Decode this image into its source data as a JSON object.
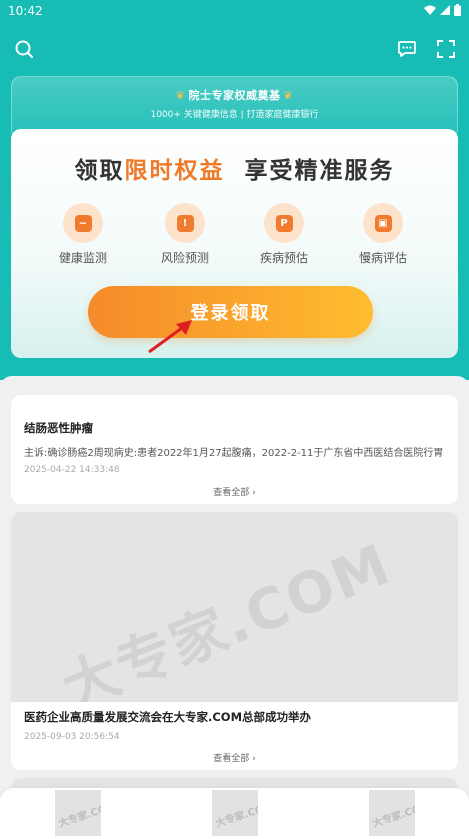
{
  "status_bar": {
    "time": "10:42"
  },
  "banner": {
    "line1": "院士专家权威奠基",
    "line2": "1000+ 关键健康信息 | 打造家庭健康银行"
  },
  "promo": {
    "headline_a": "领取",
    "headline_highlight": "限时权益",
    "headline_b": "享受精准服务",
    "features": [
      {
        "label": "健康监测",
        "icon": "chart-icon"
      },
      {
        "label": "风险预测",
        "icon": "alarm-icon"
      },
      {
        "label": "疾病预估",
        "icon": "document-icon"
      },
      {
        "label": "慢病评估",
        "icon": "badge-icon"
      }
    ],
    "button_label": "登录领取"
  },
  "articles": [
    {
      "title": "结肠恶性肿瘤",
      "desc": "主诉:确诊肠癌2周现病史:患者2022年1月27起腹痛，2022-2-11于广东省中西医结合医院行胃",
      "time": "2025-04-22 14:33:48",
      "more": "查看全部"
    },
    {
      "image_text": "大专家.COM",
      "title": "医药企业高质量发展交流会在大专家.COM总部成功举办",
      "time": "2025-09-03 20:56:54",
      "more": "查看全部"
    }
  ],
  "bottom_thumbs": [
    "大专家.COM",
    "大专家.COM",
    "大专家.COM"
  ],
  "colors": {
    "teal": "#17bdb5",
    "orange": "#f07b2f",
    "button_start": "#f58a2a",
    "button_end": "#ffbd2f"
  }
}
